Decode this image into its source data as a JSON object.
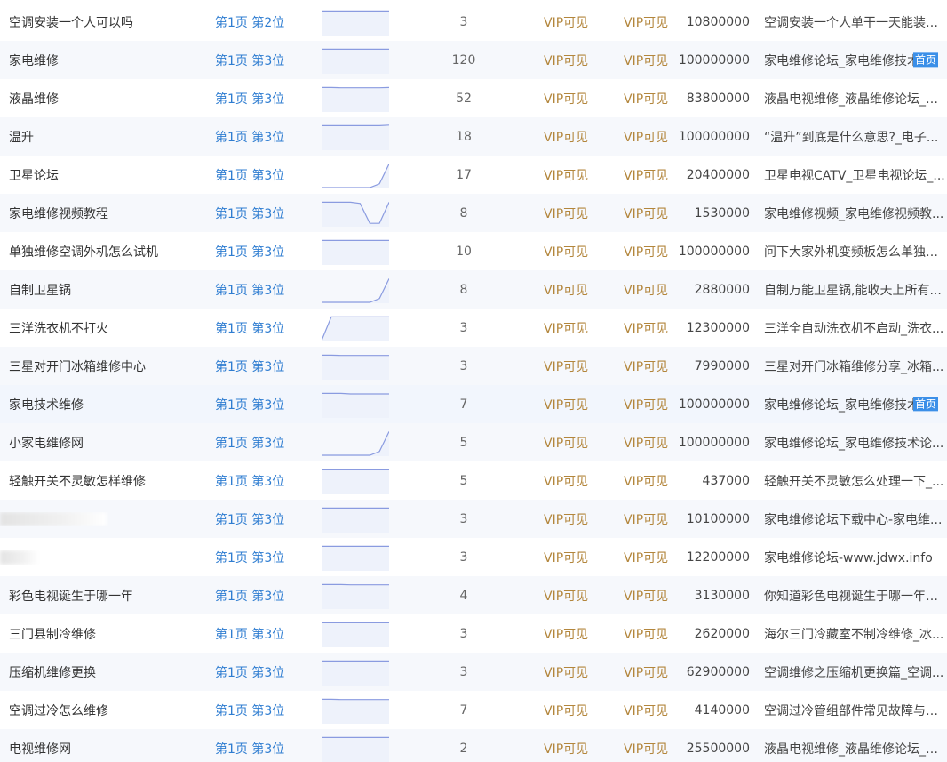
{
  "rank_prefix": "第1页",
  "vip_label": "VIP可见",
  "badge_label": "首页",
  "rows": [
    {
      "keyword": "空调安装一个人可以吗",
      "rank": "第1页 第2位",
      "count": "3",
      "index": "10800000",
      "title": "空调安装一个人单干一天能装多...",
      "trend": [
        0.05,
        0.05,
        0.05,
        0.05,
        0.05,
        0.05,
        0.05,
        0.05
      ],
      "badge": false,
      "blur": false
    },
    {
      "keyword": "家电维修",
      "rank": "第1页 第3位",
      "count": "120",
      "index": "100000000",
      "title": "家电维修论坛_家电维修技术论",
      "trend": [
        0.05,
        0.05,
        0.05,
        0.05,
        0.05,
        0.05,
        0.05,
        0.05
      ],
      "badge": true,
      "blur": false
    },
    {
      "keyword": "液晶维修",
      "rank": "第1页 第3位",
      "count": "52",
      "index": "83800000",
      "title": "液晶电视维修_液晶维修论坛_液...",
      "trend": [
        0.05,
        0.05,
        0.06,
        0.06,
        0.06,
        0.06,
        0.06,
        0.05
      ],
      "badge": false,
      "blur": false
    },
    {
      "keyword": "温升",
      "rank": "第1页 第3位",
      "count": "18",
      "index": "100000000",
      "title": "“温升”到底是什么意思?_电子...",
      "trend": [
        0.05,
        0.05,
        0.05,
        0.05,
        0.05,
        0.05,
        0.05,
        0.03
      ],
      "badge": false,
      "blur": false
    },
    {
      "keyword": "卫星论坛",
      "rank": "第1页 第3位",
      "count": "17",
      "index": "20400000",
      "title": "卫星电视CATV_卫星电视论坛_...",
      "trend": [
        1,
        1,
        1,
        1,
        1,
        1,
        0.85,
        0.05
      ],
      "badge": false,
      "blur": false
    },
    {
      "keyword": "家电维修视频教程",
      "rank": "第1页 第3位",
      "count": "8",
      "index": "1530000",
      "title": "家电维修视频_家电维修视频教...",
      "trend": [
        0.05,
        0.05,
        0.05,
        0.05,
        0.1,
        0.9,
        0.9,
        0.05
      ],
      "badge": false,
      "blur": false
    },
    {
      "keyword": "单独维修空调外机怎么试机",
      "rank": "第1页 第3位",
      "count": "10",
      "index": "100000000",
      "title": "问下大家外机变频板怎么单独测...",
      "trend": [
        0.05,
        0.05,
        0.05,
        0.05,
        0.05,
        0.05,
        0.05,
        0.05
      ],
      "badge": false,
      "blur": false
    },
    {
      "keyword": "自制卫星锅",
      "rank": "第1页 第3位",
      "count": "8",
      "index": "2880000",
      "title": "自制万能卫星锅,能收天上所有...",
      "trend": [
        1,
        1,
        1,
        1,
        1,
        1,
        0.85,
        0.05
      ],
      "badge": false,
      "blur": false
    },
    {
      "keyword": "三洋洗衣机不打火",
      "rank": "第1页 第3位",
      "count": "3",
      "index": "12300000",
      "title": "三洋全自动洗衣机不启动_洗衣...",
      "trend": [
        1,
        0.05,
        0.05,
        0.05,
        0.05,
        0.05,
        0.05,
        0.05
      ],
      "badge": false,
      "blur": false
    },
    {
      "keyword": "三星对开门冰箱维修中心",
      "rank": "第1页 第3位",
      "count": "3",
      "index": "7990000",
      "title": "三星对开门冰箱维修分享_冰箱...",
      "trend": [
        0.05,
        0.05,
        0.06,
        0.06,
        0.06,
        0.06,
        0.06,
        0.06
      ],
      "badge": false,
      "blur": false
    },
    {
      "keyword": "家电技术维修",
      "rank": "第1页 第3位",
      "count": "7",
      "index": "100000000",
      "title": "家电维修论坛_家电维修技术论",
      "trend": [
        0.05,
        0.05,
        0.05,
        0.07,
        0.07,
        0.07,
        0.07,
        0.07
      ],
      "badge": true,
      "blur": false
    },
    {
      "keyword": "小家电维修网",
      "rank": "第1页 第3位",
      "count": "5",
      "index": "100000000",
      "title": "家电维修论坛_家电维修技术论...",
      "trend": [
        1,
        1,
        1,
        1,
        1,
        1,
        0.85,
        0.05
      ],
      "badge": false,
      "blur": false
    },
    {
      "keyword": "轻触开关不灵敏怎样维修",
      "rank": "第1页 第3位",
      "count": "5",
      "index": "437000",
      "title": "轻触开关不灵敏怎么处理一下_...",
      "trend": [
        0.05,
        0.05,
        0.05,
        0.05,
        0.05,
        0.05,
        0.05,
        0.05
      ],
      "badge": false,
      "blur": false
    },
    {
      "keyword": "",
      "rank": "第1页 第3位",
      "count": "3",
      "index": "10100000",
      "title": "家电维修论坛下载中心-家电维...",
      "trend": [
        0.05,
        0.05,
        0.05,
        0.05,
        0.05,
        0.05,
        0.05,
        0.05
      ],
      "badge": false,
      "blur": true
    },
    {
      "keyword": "",
      "rank": "第1页 第3位",
      "count": "3",
      "index": "12200000",
      "title": "家电维修论坛-www.jdwx.info",
      "trend": [
        0.05,
        0.05,
        0.05,
        0.05,
        0.05,
        0.05,
        0.05,
        0.05
      ],
      "badge": false,
      "blur": true
    },
    {
      "keyword": "彩色电视诞生于哪一年",
      "rank": "第1页 第3位",
      "count": "4",
      "index": "3130000",
      "title": "你知道彩色电视诞生于哪一年吗...",
      "trend": [
        0.05,
        0.05,
        0.05,
        0.06,
        0.06,
        0.06,
        0.06,
        0.06
      ],
      "badge": false,
      "blur": false
    },
    {
      "keyword": "三门县制冷维修",
      "rank": "第1页 第3位",
      "count": "3",
      "index": "2620000",
      "title": "海尔三门冷藏室不制冷维修_冰...",
      "trend": [
        0.05,
        0.05,
        0.05,
        0.05,
        0.05,
        0.05,
        0.05,
        0.05
      ],
      "badge": false,
      "blur": false
    },
    {
      "keyword": "压缩机维修更换",
      "rank": "第1页 第3位",
      "count": "3",
      "index": "62900000",
      "title": "空调维修之压缩机更换篇_空调...",
      "trend": [
        0.05,
        0.05,
        0.05,
        0.05,
        0.05,
        0.05,
        0.05,
        0.05
      ],
      "badge": false,
      "blur": false
    },
    {
      "keyword": "空调过冷怎么维修",
      "rank": "第1页 第3位",
      "count": "7",
      "index": "4140000",
      "title": "空调过冷管组部件常见故障与检...",
      "trend": [
        0.05,
        0.05,
        0.06,
        0.06,
        0.06,
        0.06,
        0.06,
        0.06
      ],
      "badge": false,
      "blur": false
    },
    {
      "keyword": "电视维修网",
      "rank": "第1页 第3位",
      "count": "2",
      "index": "25500000",
      "title": "液晶电视维修_液晶维修论坛_液...",
      "trend": [
        0.05,
        0.05,
        0.05,
        0.05,
        0.05,
        0.05,
        0.05,
        0.05
      ],
      "badge": false,
      "blur": false
    }
  ]
}
